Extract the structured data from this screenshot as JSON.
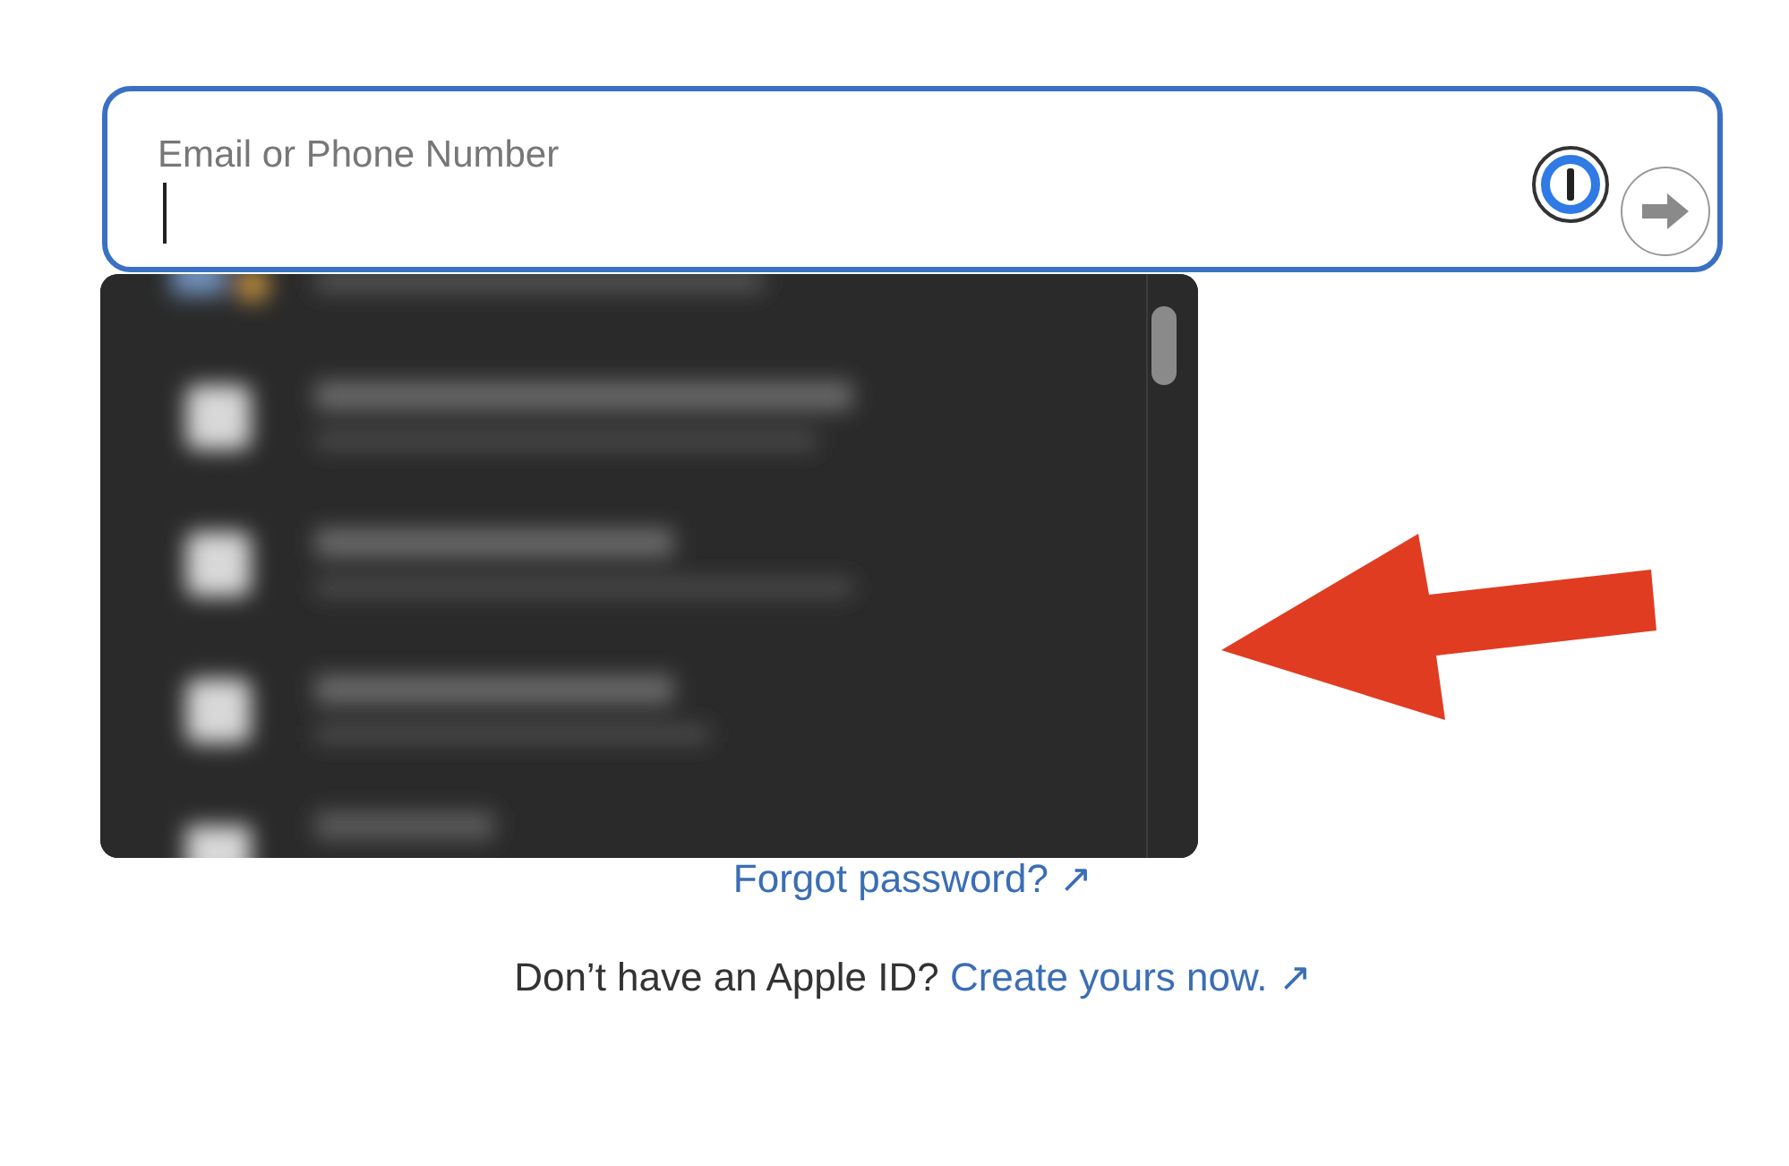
{
  "sign_in_field": {
    "placeholder": "Email or Phone Number",
    "focused": true
  },
  "suggestions_popup": {
    "kind": "blurred"
  },
  "forgot_link": "Forgot password? ↗",
  "create_account": {
    "prompt": "Don’t have an Apple ID?",
    "link": "Create yours now. ↗"
  }
}
